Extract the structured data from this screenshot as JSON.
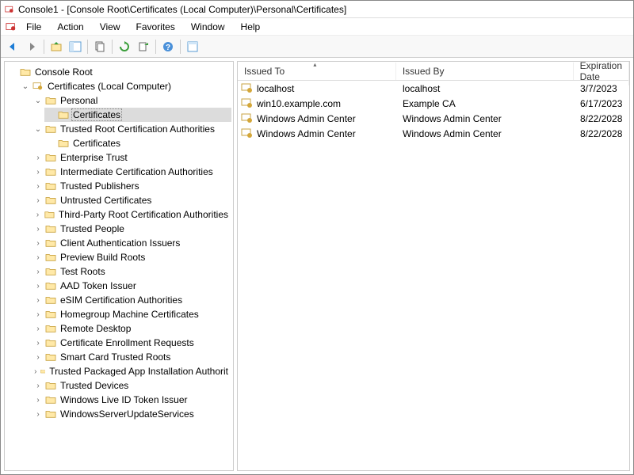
{
  "window": {
    "title": "Console1 - [Console Root\\Certificates (Local Computer)\\Personal\\Certificates]"
  },
  "menu": {
    "file": "File",
    "action": "Action",
    "view": "View",
    "favorites": "Favorites",
    "window": "Window",
    "help": "Help"
  },
  "tree": {
    "root": "Console Root",
    "certs": "Certificates (Local Computer)",
    "personal": "Personal",
    "personal_certs": "Certificates",
    "trca": "Trusted Root Certification Authorities",
    "trca_certs": "Certificates",
    "enterprise_trust": "Enterprise Trust",
    "intermediate_ca": "Intermediate Certification Authorities",
    "trusted_publishers": "Trusted Publishers",
    "untrusted": "Untrusted Certificates",
    "thirdparty": "Third-Party Root Certification Authorities",
    "trusted_people": "Trusted People",
    "client_auth": "Client Authentication Issuers",
    "preview_build": "Preview Build Roots",
    "test_roots": "Test Roots",
    "aad": "AAD Token Issuer",
    "esim": "eSIM Certification Authorities",
    "homegroup": "Homegroup Machine Certificates",
    "remote_desktop": "Remote Desktop",
    "cert_enroll": "Certificate Enrollment Requests",
    "smartcard": "Smart Card Trusted Roots",
    "trusted_pkg": "Trusted Packaged App Installation Authorit",
    "trusted_devices": "Trusted Devices",
    "winlive": "Windows Live ID Token Issuer",
    "wsus": "WindowsServerUpdateServices"
  },
  "columns": {
    "issued_to": "Issued To",
    "issued_by": "Issued By",
    "expiration": "Expiration Date"
  },
  "rows": [
    {
      "issued_to": "localhost",
      "issued_by": "localhost",
      "expiration": "3/7/2023"
    },
    {
      "issued_to": "win10.example.com",
      "issued_by": "Example CA",
      "expiration": "6/17/2023"
    },
    {
      "issued_to": "Windows Admin Center",
      "issued_by": "Windows Admin Center",
      "expiration": "8/22/2028"
    },
    {
      "issued_to": "Windows Admin Center",
      "issued_by": "Windows Admin Center",
      "expiration": "8/22/2028"
    }
  ]
}
